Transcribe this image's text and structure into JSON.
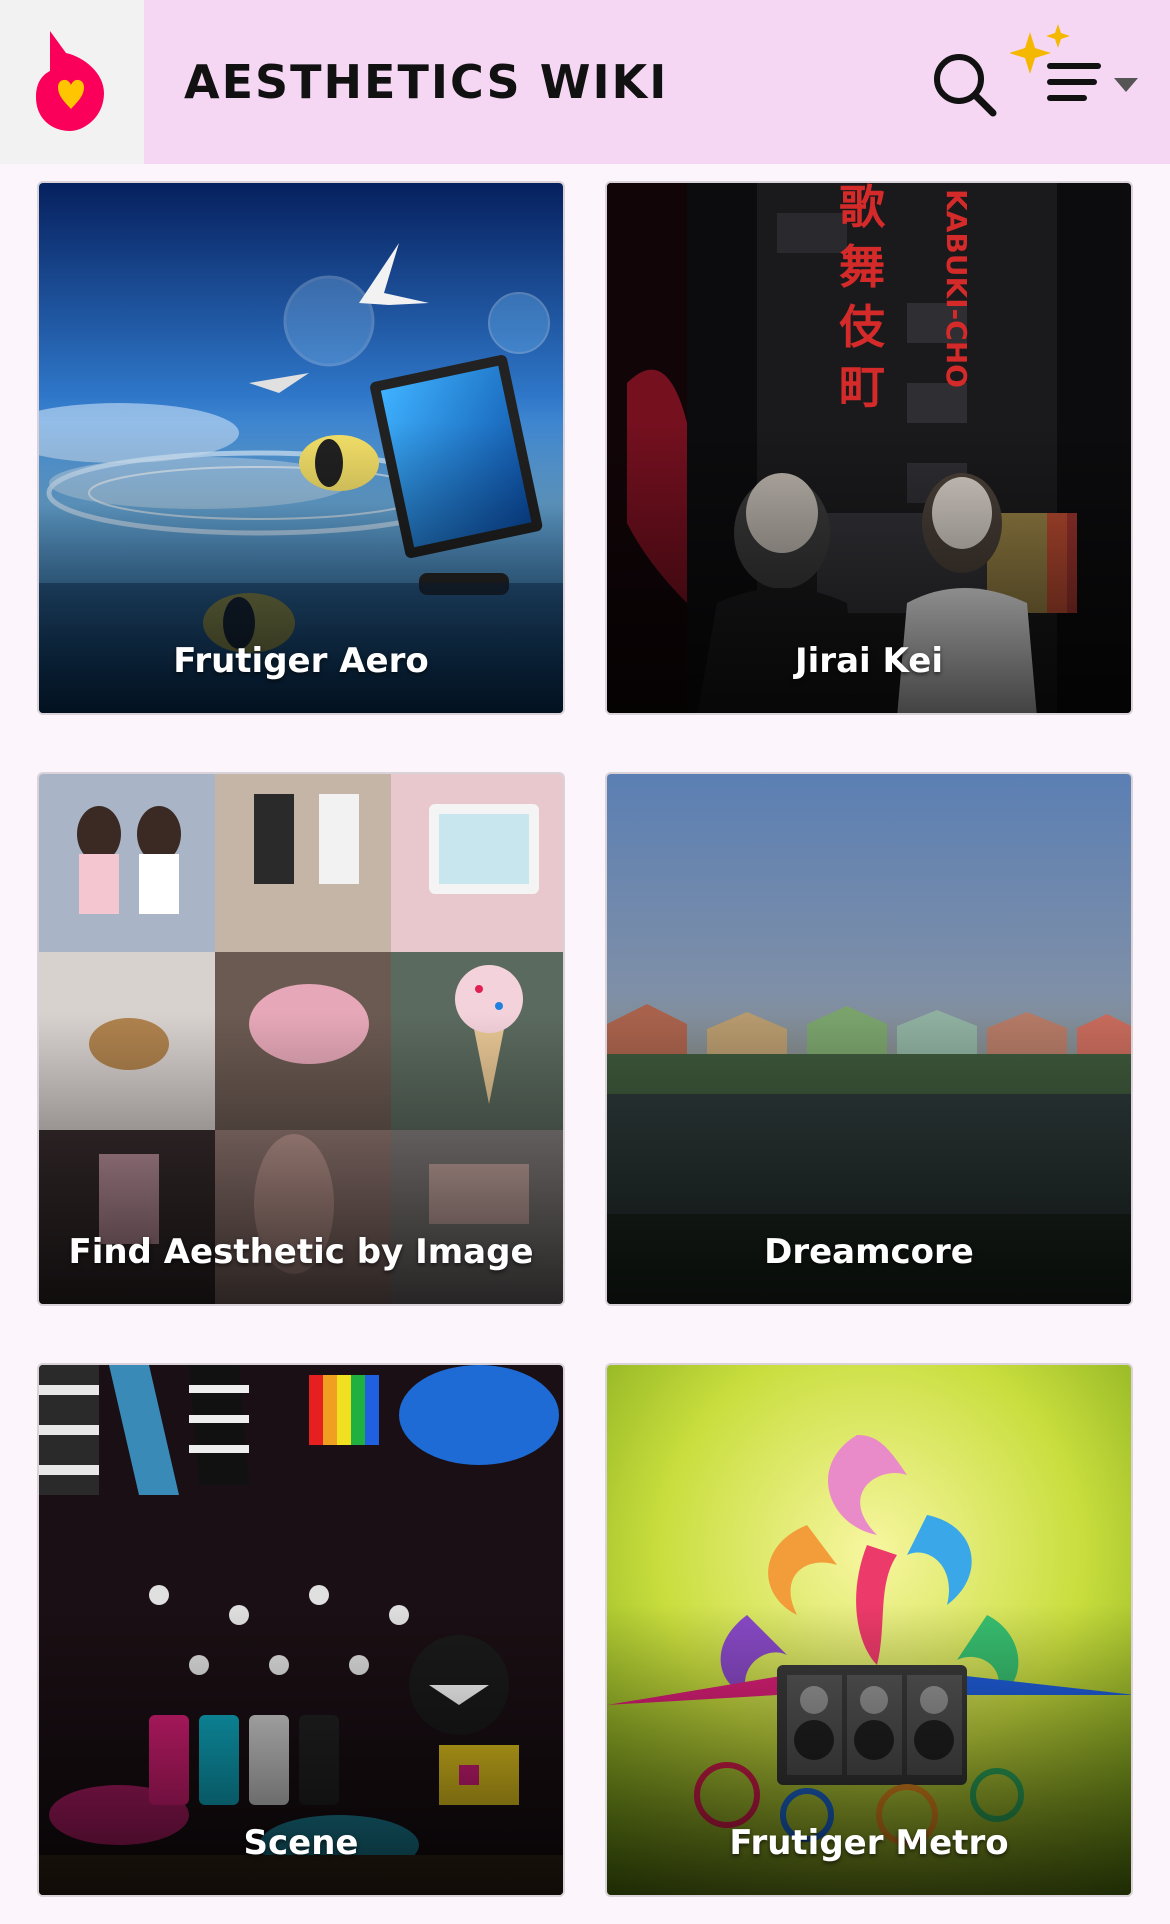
{
  "header": {
    "title": "AESTHETICS WIKI",
    "logo_icon": "fandom-heart-flame-icon",
    "search_icon": "search-icon",
    "menu_icon": "sparkle-menu-icon",
    "dropdown_icon": "caret-down-icon",
    "colors": {
      "bar": "#f5d7f3",
      "logo_bg": "#f2f2f2",
      "brand": "#fa005a",
      "heart": "#ffc500"
    }
  },
  "cards": [
    {
      "label": "Frutiger Aero"
    },
    {
      "label": "Jirai Kei",
      "sign_text": "KABUKI-CHO",
      "sign_kanji": "歌舞伎町"
    },
    {
      "label": "Find Aesthetic by Image"
    },
    {
      "label": "Dreamcore"
    },
    {
      "label": "Scene"
    },
    {
      "label": "Frutiger Metro"
    }
  ]
}
